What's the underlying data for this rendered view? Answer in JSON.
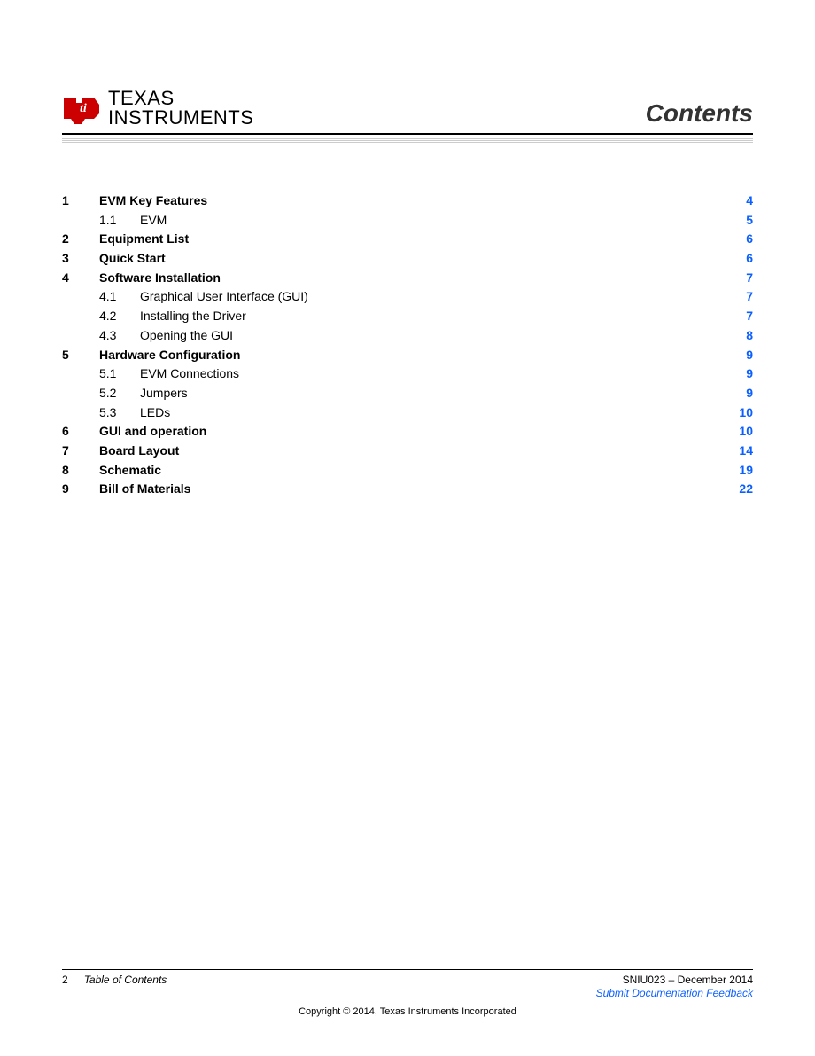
{
  "header": {
    "logo_line1": "TEXAS",
    "logo_line2": "INSTRUMENTS",
    "title": "Contents"
  },
  "toc": [
    {
      "level": 1,
      "num": "1",
      "title": "EVM Key Features",
      "page": "4"
    },
    {
      "level": 2,
      "num": "1.1",
      "title": "EVM",
      "page": "5"
    },
    {
      "level": 1,
      "num": "2",
      "title": "Equipment List",
      "page": "6"
    },
    {
      "level": 1,
      "num": "3",
      "title": "Quick Start",
      "page": "6"
    },
    {
      "level": 1,
      "num": "4",
      "title": "Software Installation",
      "page": "7"
    },
    {
      "level": 2,
      "num": "4.1",
      "title": "Graphical User Interface (GUI)",
      "page": "7"
    },
    {
      "level": 2,
      "num": "4.2",
      "title": "Installing the Driver",
      "page": "7"
    },
    {
      "level": 2,
      "num": "4.3",
      "title": "Opening the GUI",
      "page": "8"
    },
    {
      "level": 1,
      "num": "5",
      "title": "Hardware Configuration",
      "page": "9"
    },
    {
      "level": 2,
      "num": "5.1",
      "title": "EVM Connections",
      "page": "9"
    },
    {
      "level": 2,
      "num": "5.2",
      "title": "Jumpers",
      "page": "9"
    },
    {
      "level": 2,
      "num": "5.3",
      "title": "LEDs",
      "page": "10"
    },
    {
      "level": 1,
      "num": "6",
      "title": "GUI and operation",
      "page": "10"
    },
    {
      "level": 1,
      "num": "7",
      "title": "Board Layout",
      "page": "14"
    },
    {
      "level": 1,
      "num": "8",
      "title": "Schematic",
      "page": "19"
    },
    {
      "level": 1,
      "num": "9",
      "title": "Bill of Materials",
      "page": "22"
    }
  ],
  "footer": {
    "page_number": "2",
    "footer_title": "Table of Contents",
    "doc_id": "SNIU023 – December 2014",
    "feedback": "Submit Documentation Feedback",
    "copyright": "Copyright © 2014, Texas Instruments Incorporated"
  }
}
